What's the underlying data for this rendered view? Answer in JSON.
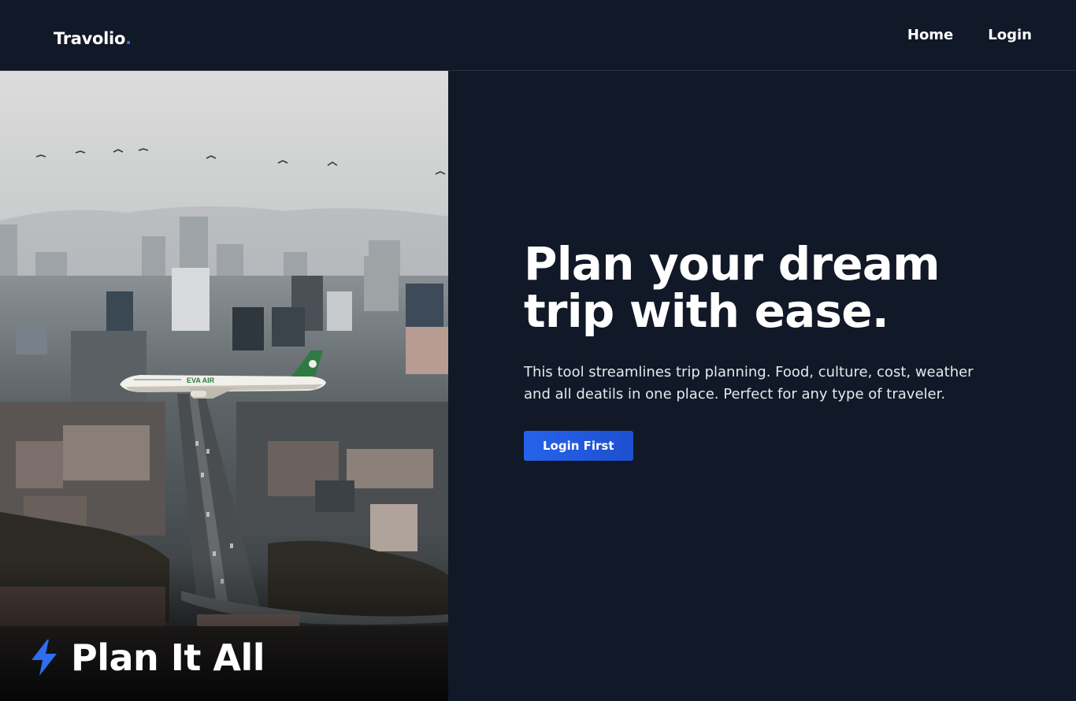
{
  "brand": {
    "name": "Travolio",
    "dot": "."
  },
  "nav": {
    "items": [
      {
        "label": "Home"
      },
      {
        "label": "Login"
      }
    ]
  },
  "hero": {
    "headline_line1": "Plan your dream",
    "headline_line2": "trip with ease.",
    "description": "This tool streamlines trip planning. Food, culture, cost, weather and all deatils in one place. Perfect for any type of traveler.",
    "cta_label": "Login First"
  },
  "image": {
    "caption": "Plan It All",
    "caption_icon": "lightning-bolt-icon",
    "airplane_livery": "EVA AIR"
  },
  "colors": {
    "background": "#111827",
    "accent": "#2563eb",
    "text": "#ffffff"
  }
}
